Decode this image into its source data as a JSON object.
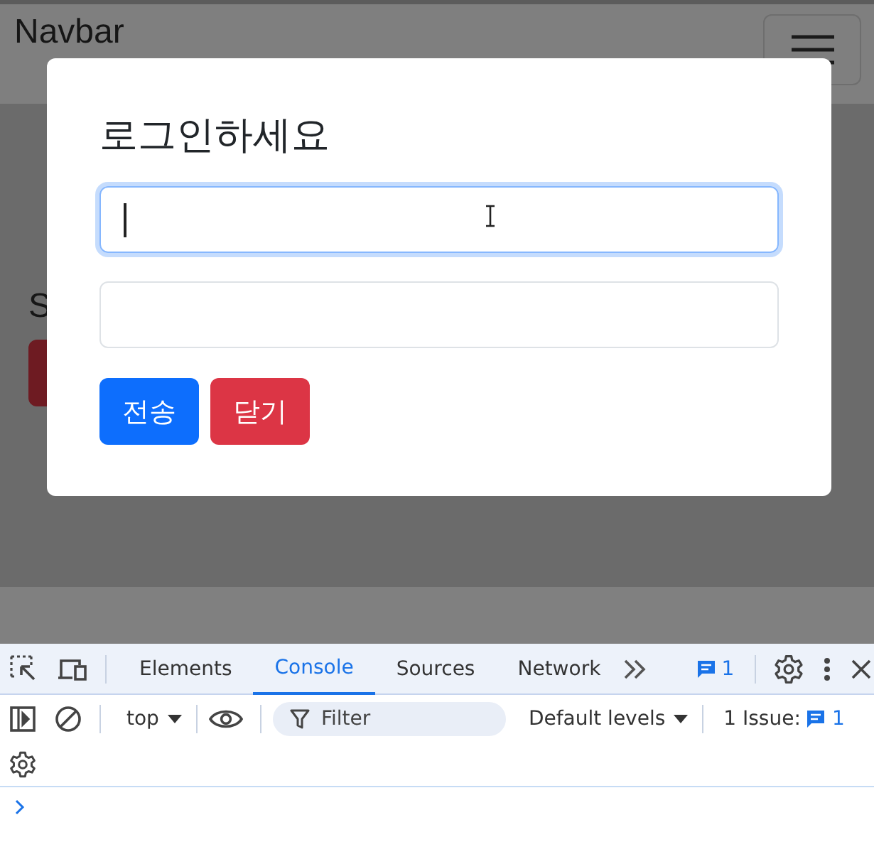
{
  "page": {
    "navbar": {
      "brand": "Navbar"
    },
    "heading": "S"
  },
  "modal": {
    "title": "로그인하세요",
    "fields": [
      {
        "focused": true
      },
      {
        "focused": false
      }
    ],
    "buttons": [
      {
        "label": "전송",
        "kind": "primary"
      },
      {
        "label": "닫기",
        "kind": "danger"
      }
    ]
  },
  "devtools": {
    "tabs": [
      {
        "label": "Elements",
        "selected": false
      },
      {
        "label": "Console",
        "selected": true
      },
      {
        "label": "Sources",
        "selected": false
      },
      {
        "label": "Network",
        "selected": false
      }
    ],
    "message_count": "1",
    "context": "top",
    "filter_placeholder": "Filter",
    "levels": "Default levels",
    "issues_label": "1 Issue:",
    "issues_count": "1"
  }
}
